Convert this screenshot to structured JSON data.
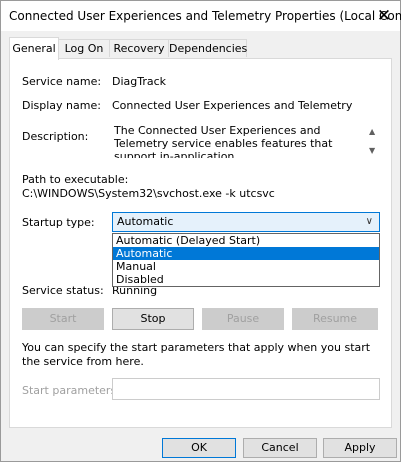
{
  "window": {
    "title": "Connected User Experiences and Telemetry Properties (Local Com...",
    "close_glyph": "✕"
  },
  "tabs": [
    {
      "label": "General",
      "active": true
    },
    {
      "label": "Log On",
      "active": false
    },
    {
      "label": "Recovery",
      "active": false
    },
    {
      "label": "Dependencies",
      "active": false
    }
  ],
  "general": {
    "service_name_label": "Service name:",
    "service_name_value": "DiagTrack",
    "display_name_label": "Display name:",
    "display_name_value": "Connected User Experiences and Telemetry",
    "description_label": "Description:",
    "description_value": "The Connected User Experiences and Telemetry service enables features that support in-application",
    "path_label": "Path to executable:",
    "path_value": "C:\\WINDOWS\\System32\\svchost.exe -k utcsvc",
    "startup_type_label": "Startup type:",
    "startup_type_value": "Automatic",
    "startup_options": [
      "Automatic (Delayed Start)",
      "Automatic",
      "Manual",
      "Disabled"
    ],
    "startup_selected_index": 1,
    "service_status_label": "Service status:",
    "service_status_value": "Running",
    "buttons": {
      "start": "Start",
      "stop": "Stop",
      "pause": "Pause",
      "resume": "Resume"
    },
    "start_params_help": "You can specify the start parameters that apply when you start the service from here.",
    "start_params_label": "Start parameters:",
    "start_params_value": ""
  },
  "footer": {
    "ok": "OK",
    "cancel": "Cancel",
    "apply": "Apply"
  },
  "colors": {
    "accent": "#0078d7",
    "window_bg": "#f0f0f0",
    "panel_bg": "#ffffff",
    "disabled_text": "#a0a0a0"
  },
  "icons": {
    "close": "close-icon",
    "select_chevron": "chevron-down-icon",
    "scroll_up": "scroll-up-icon",
    "scroll_down": "scroll-down-icon"
  }
}
